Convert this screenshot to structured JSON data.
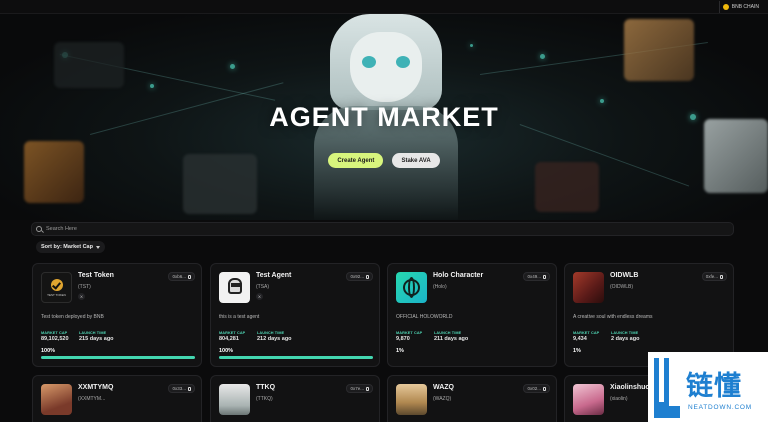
{
  "topbar": {
    "chain_label": "BNB CHAIN"
  },
  "hero": {
    "title": "AGENT MARKET",
    "primary_button": "Create Agent",
    "secondary_button": "Stake AVA"
  },
  "search": {
    "placeholder": "Search Here"
  },
  "sort": {
    "label": "Sort by: Market Cap"
  },
  "labels": {
    "market_cap": "MARKET CAP",
    "launch_time": "LAUNCH TIME"
  },
  "cards": [
    {
      "name": "Test Token",
      "ticker": "(TST)",
      "address": "0xb6...",
      "description": "Test token deployed by BNB",
      "market_cap": "89,102,520",
      "launch_time": "215 days ago",
      "progress_text": "100%",
      "progress": 1.0,
      "thumb_text": "TEST TOKEN"
    },
    {
      "name": "Test Agent",
      "ticker": "(TSA)",
      "address": "0x92...",
      "description": "this is a test agent",
      "market_cap": "804,281",
      "launch_time": "212 days ago",
      "progress_text": "100%",
      "progress": 1.0
    },
    {
      "name": "Holo Character",
      "ticker": "(Holo)",
      "address": "0x49...",
      "description": "OFFICIAL HOLOWORLD",
      "market_cap": "9,870",
      "launch_time": "211 days ago",
      "progress_text": "1%",
      "progress": 0.01
    },
    {
      "name": "OIDWLB",
      "ticker": "(OIDWLB)",
      "address": "0xfe...",
      "description": "A creative soul with endless dreams",
      "market_cap": "9,434",
      "launch_time": "2 days ago",
      "progress_text": "1%",
      "progress": 0.01
    },
    {
      "name": "XXMTYMQ",
      "ticker": "(XXMTYM...",
      "address": "0x33..."
    },
    {
      "name": "TTKQ",
      "ticker": "(TTKQ)",
      "address": "0x7e..."
    },
    {
      "name": "WAZQ",
      "ticker": "(WAZQ)",
      "address": "0x02..."
    },
    {
      "name": "Xiaolinshuo",
      "ticker": "(xiaolin)",
      "address": ""
    }
  ],
  "logo": {
    "cn": "链懂",
    "en": "NEATDOWN.COM"
  },
  "colors": {
    "accent": "#d8f57d",
    "teal": "#43d6b0",
    "background": "#0b0b0c"
  }
}
